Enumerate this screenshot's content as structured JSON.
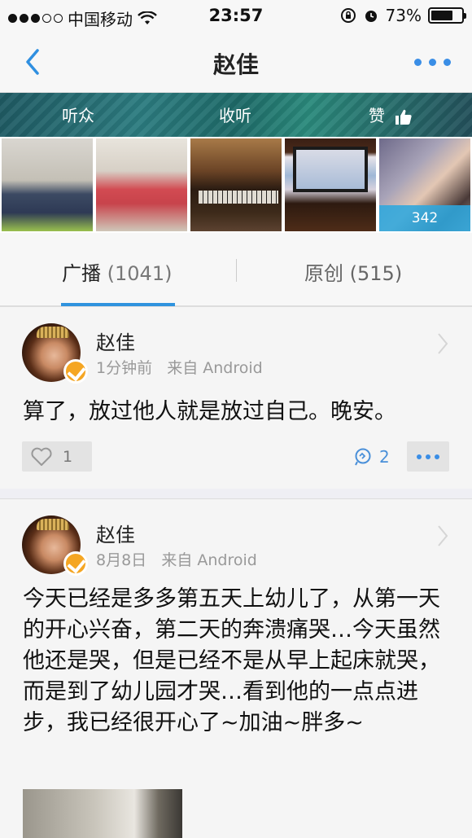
{
  "status_bar": {
    "carrier": "中国移动",
    "time": "23:57",
    "battery_percent": "73%",
    "battery_level": 0.73
  },
  "nav": {
    "title": "赵佳",
    "back_icon": "chevron-left-icon",
    "more_icon": "more-dots-icon"
  },
  "stats": [
    {
      "label": "听众"
    },
    {
      "label": "收听"
    },
    {
      "label": "赞"
    }
  ],
  "photos": {
    "count": "342"
  },
  "tabs": [
    {
      "label": "广播",
      "count": "(1041)",
      "active": true
    },
    {
      "label": "原创",
      "count": "(515)",
      "active": false
    }
  ],
  "posts": [
    {
      "author": "赵佳",
      "time": "1分钟前",
      "source": "来自 Android",
      "text": "算了，放过他人就是放过自己。晚安。",
      "likes": "1",
      "comments": "2"
    },
    {
      "author": "赵佳",
      "time": "8月8日",
      "source": "来自 Android",
      "text": "今天已经是多多第五天上幼儿了，从第一天的开心兴奋，第二天的奔溃痛哭…今天虽然他还是哭，但是已经不是从早上起床就哭，而是到了幼儿园才哭…看到他的一点点进步，我已经很开心了~加油~胖多~"
    }
  ],
  "colors": {
    "accent": "#2f93de",
    "verified_badge": "#f5a623",
    "photo_count_bg": "#2ea7de"
  }
}
